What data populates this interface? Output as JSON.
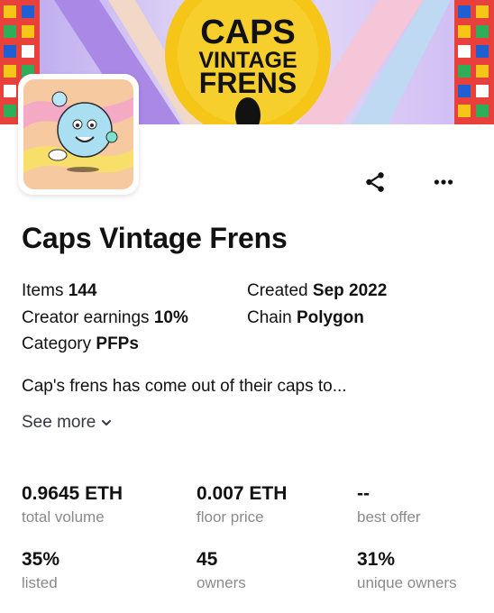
{
  "banner": {
    "line1": "CAPS",
    "line2": "VINTAGE",
    "line3": "FRENS"
  },
  "collection": {
    "name": "Caps Vintage Frens",
    "items_label": "Items",
    "items_value": "144",
    "created_label": "Created",
    "created_value": "Sep 2022",
    "earnings_label": "Creator earnings",
    "earnings_value": "10%",
    "chain_label": "Chain",
    "chain_value": "Polygon",
    "category_label": "Category",
    "category_value": "PFPs",
    "description": "Cap's frens has come out of their caps to...",
    "see_more": "See more"
  },
  "stats": [
    {
      "value": "0.9645 ETH",
      "label": "total volume"
    },
    {
      "value": "0.007 ETH",
      "label": "floor price"
    },
    {
      "value": "--",
      "label": "best offer"
    },
    {
      "value": "35%",
      "label": "listed"
    },
    {
      "value": "45",
      "label": "owners"
    },
    {
      "value": "31%",
      "label": "unique owners"
    }
  ],
  "icons": {
    "share": "share-icon",
    "more": "more-horizontal-icon",
    "chevron": "chevron-down-icon"
  },
  "colors": {
    "banner_yellow": "#f5c518",
    "banner_lavender": "#c9b8f0",
    "avatar_bg": "#f7c9a0",
    "text": "#121212",
    "muted": "#8a8a8a"
  }
}
